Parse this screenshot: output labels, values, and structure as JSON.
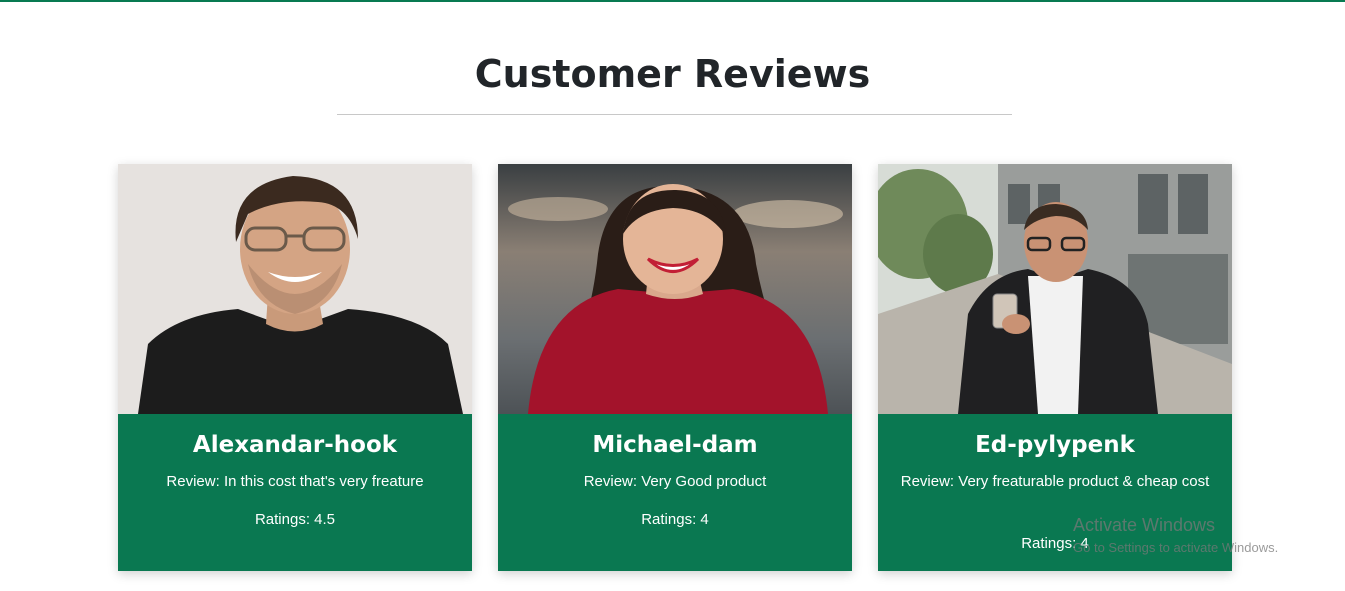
{
  "section": {
    "title": "Customer Reviews"
  },
  "reviews": [
    {
      "name": "Alexandar-hook",
      "review": "Review: In this cost that's very freature",
      "rating": "Ratings: 4.5",
      "photo": "man-with-glasses-black-tshirt-portrait"
    },
    {
      "name": "Michael-dam",
      "review": "Review: Very Good product",
      "rating": "Ratings: 4",
      "photo": "smiling-woman-red-top-portrait"
    },
    {
      "name": "Ed-pylypenk",
      "review": "Review: Very freaturable product & cheap cost",
      "rating": "Ratings: 4",
      "photo": "man-with-phone-on-street-portrait"
    }
  ],
  "watermark": {
    "title": "Activate Windows",
    "subtitle": "Go to Settings to activate Windows."
  },
  "colors": {
    "accent": "#0a7851",
    "heading": "#212529"
  }
}
